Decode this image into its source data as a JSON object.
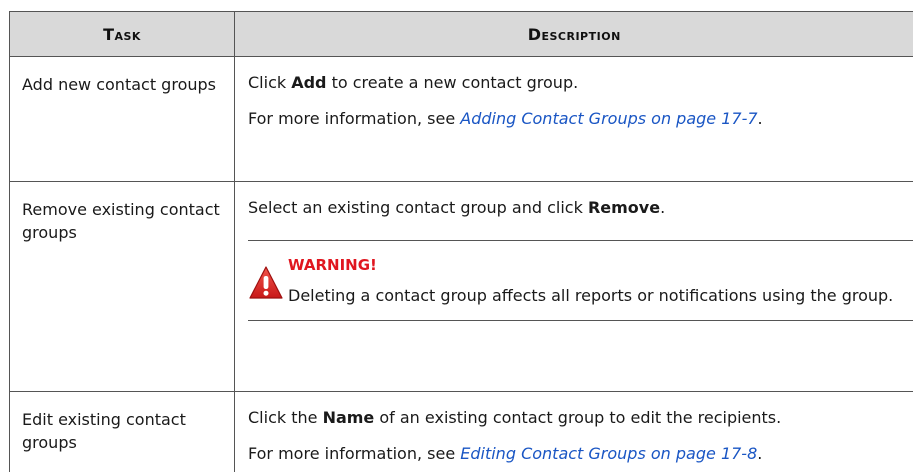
{
  "table": {
    "header": {
      "task": "Task",
      "description": "Description"
    },
    "rows": [
      {
        "task": "Add new contact groups",
        "desc_line1": {
          "pre": "Click ",
          "bold": "Add",
          "post": " to create a new contact group."
        },
        "desc_line2": {
          "pre": "For more information, see ",
          "link": "Adding Contact Groups on page 17-7",
          "post": "."
        }
      },
      {
        "task": "Remove existing contact groups",
        "desc_line1": {
          "pre": "Select an existing contact group and click ",
          "bold": "Remove",
          "post": "."
        },
        "warning": {
          "title": "WARNING!",
          "body": "Deleting a contact group affects all reports or notifications using the group.",
          "icon": "warning-triangle-icon",
          "color": "#e0161f"
        }
      },
      {
        "task": "Edit existing contact groups",
        "desc_line1": {
          "pre": "Click the ",
          "bold": "Name",
          "post": " of an existing contact group to edit the recipients."
        },
        "desc_line2": {
          "pre": "For more information, see ",
          "link": "Editing Contact Groups on page 17-8",
          "post": "."
        }
      }
    ]
  },
  "colors": {
    "header_bg": "#d9d9d9",
    "link": "#1a56c4",
    "warning": "#e0161f"
  }
}
